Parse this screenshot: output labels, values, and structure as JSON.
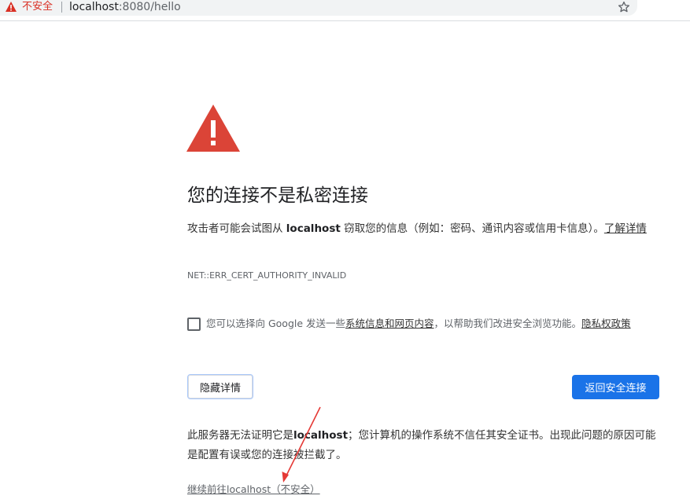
{
  "browser": {
    "security_label": "不安全",
    "url_host": "localhost",
    "url_rest": ":8080/hello",
    "icons": {
      "warning": "warning-triangle-icon",
      "star": "star-icon"
    }
  },
  "interstitial": {
    "heading": "您的连接不是私密连接",
    "intro_before": "攻击者可能会试图从 ",
    "intro_host": "localhost",
    "intro_after": " 窃取您的信息（例如：密码、通讯内容或信用卡信息）。",
    "learn_more": "了解详情",
    "error_code": "NET::ERR_CERT_AUTHORITY_INVALID",
    "opt_in": {
      "prefix": "您可以选择向 Google 发送一些",
      "link1": "系统信息和网页内容",
      "middle": "，以帮助我们改进安全浏览功能。",
      "link2": "隐私权政策"
    },
    "hide_details_button": "隐藏详情",
    "back_to_safety_button": "返回安全连接",
    "details_before": "此服务器无法证明它是",
    "details_host": "localhost",
    "details_after": "；您计算机的操作系统不信任其安全证书。出现此问题的原因可能是配置有误或您的连接被拦截了。",
    "proceed_link": "继续前往localhost（不安全）"
  },
  "colors": {
    "warning_red": "#d93025",
    "icon_red": "#db4437",
    "primary_blue": "#1a73e8",
    "annotation_arrow": "#e53935"
  }
}
